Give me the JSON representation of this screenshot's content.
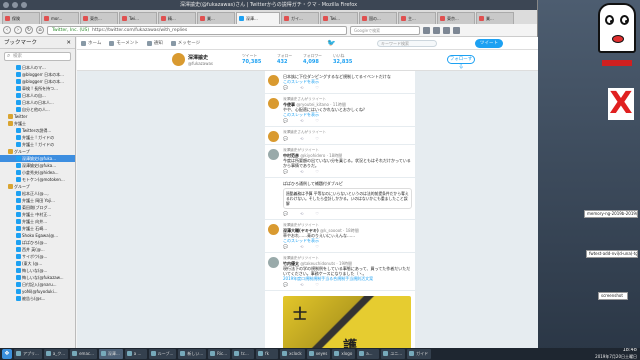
{
  "window": {
    "title": "深澤諭史(@fukazawas)さん | Twitterからの説得ガチ・クマ - Mozilla Firefox"
  },
  "tabs": [
    {
      "label": "保険"
    },
    {
      "label": "mor...",
      "active": false
    },
    {
      "label": "東京..."
    },
    {
      "label": "Twi..."
    },
    {
      "label": "精..."
    },
    {
      "label": "業..."
    },
    {
      "label": "深澤...",
      "active": true
    },
    {
      "label": "ガイ..."
    },
    {
      "label": "Twi..."
    },
    {
      "label": "国の..."
    },
    {
      "label": "主..."
    },
    {
      "label": "東京..."
    },
    {
      "label": "業..."
    }
  ],
  "url": {
    "site": "Twitter, Inc. (US)",
    "path": "https://twitter.com/fukazawas/with_replies"
  },
  "search_placeholder": "Googleで検索",
  "sidebar": {
    "title": "ブックマーク",
    "search_placeholder": "検索",
    "items": [
      {
        "label": "日本人のマ...",
        "lvl": 1
      },
      {
        "label": "@bloggerr 日本の本...",
        "lvl": 1
      },
      {
        "label": "@bloggerr 日本の本...",
        "lvl": 1
      },
      {
        "label": "車検 ! 長所を持つ...",
        "lvl": 1
      },
      {
        "label": "日本人の自...",
        "lvl": 1
      },
      {
        "label": "日本人の日本人...",
        "lvl": 1
      },
      {
        "label": "自分と他の人...",
        "lvl": 1
      },
      {
        "label": "Twitter",
        "lvl": 0,
        "folder": true
      },
      {
        "label": "弁護士",
        "lvl": 0,
        "folder": true
      },
      {
        "label": "Twitterの説得...",
        "lvl": 1
      },
      {
        "label": "弁護士 ! ガイドの",
        "lvl": 1
      },
      {
        "label": "弁護士 ! ガイドの",
        "lvl": 1
      },
      {
        "label": "グループ",
        "lvl": 0,
        "folder": true
      },
      {
        "label": "深澤諭史(@fuka...",
        "lvl": 1,
        "sel": true
      },
      {
        "label": "深澤諭史(@fuka...",
        "lvl": 1
      },
      {
        "label": "小倉秀夫(@hidea...",
        "lvl": 1
      },
      {
        "label": "モトケン(@motoken...",
        "lvl": 1
      },
      {
        "label": "グループ",
        "lvl": 0,
        "folder": true
      },
      {
        "label": "松本正人(@..., ",
        "lvl": 1
      },
      {
        "label": "弁護士 岡田 Yoji...",
        "lvl": 1
      },
      {
        "label": "菊田剛(ブログ...",
        "lvl": 1
      },
      {
        "label": "弁護士 中村正...",
        "lvl": 1
      },
      {
        "label": "弁護士 向井...",
        "lvl": 1
      },
      {
        "label": "弁護士 石崎...",
        "lvl": 1
      },
      {
        "label": "Shoko Egawa(@...",
        "lvl": 1
      },
      {
        "label": "ばばひろ(@...",
        "lvl": 1
      },
      {
        "label": "西井 英(@...",
        "lvl": 1
      },
      {
        "label": "サイボウ(@...",
        "lvl": 1
      },
      {
        "label": "(東大 (@...",
        "lvl": 1
      },
      {
        "label": "悔しいな(@...",
        "lvl": 1
      },
      {
        "label": "悔しいな(@fukazaw...",
        "lvl": 1
      },
      {
        "label": "日付記入(@naru...",
        "lvl": 1
      },
      {
        "label": "yoNi(@fuyoduki...",
        "lvl": 1
      },
      {
        "label": "被告ら(@s...",
        "lvl": 1
      }
    ]
  },
  "twitter_nav": {
    "home": "ホーム",
    "moments": "モーメント",
    "notifications": "通知",
    "messages": "メッセージ"
  },
  "twitter_search_placeholder": "キーワード検索",
  "tweet_button": "ツイート",
  "profile": {
    "name": "深澤諭史",
    "handle": "@fukazawas",
    "stats": [
      {
        "label": "ツイート",
        "value": "70,385"
      },
      {
        "label": "フォロー",
        "value": "432"
      },
      {
        "label": "フォロワー",
        "value": "4,098"
      },
      {
        "label": "いいね",
        "value": "32,835"
      }
    ],
    "follow_label": "フォローする"
  },
  "tweets": [
    {
      "ctx": "",
      "name": "",
      "handle": "",
      "text": "日本族に下位ダンピングするなど規制してるイベントだけな",
      "link": "このスレッドを表示",
      "avatar": "orange"
    },
    {
      "ctx": "深澤諭史さんがリツイート",
      "name": "今使事",
      "handle": "@ryoutei_kitano · 11時間",
      "text": "やや、心配適にはいくかれないとおかしくね？",
      "link": "このスレッドを表示",
      "avatar": "orange"
    },
    {
      "ctx": "深澤諭史さんがリツイート",
      "name": "",
      "handle": "",
      "text": "",
      "link": "",
      "avatar": "orange"
    },
    {
      "ctx": "深澤諭史がリツイート",
      "name": "中村范彦",
      "handle": "@kiyohidero · 18時間",
      "text": "今度は所要額の出ていない分を乗じる。状況ともはそれだけかっているから事情でありだ。",
      "link": "",
      "avatar": "grey"
    },
    {
      "ctx": "",
      "name": "",
      "handle": "",
      "text": "ばばひろ通例して補題付ダブルピ",
      "quote": "過酷義務は予算 平等なのにいらないというのは法的前提条件だから奪えるわけない。そしたら会計しかかる。いのはないかにも重ましたこと誤解",
      "link": "",
      "avatar": ""
    },
    {
      "ctx": "深澤諭史がリツイート",
      "name": "深澤大輔(ヤキヤキ)",
      "handle": "@k_soooot · 18時間",
      "text": "草やおれ……青のりえいにぃえんな……",
      "link": "このスレッドを表示",
      "avatar": "orange"
    },
    {
      "ctx": "深澤諭史がリツイート",
      "name": "竹内優太",
      "handle": "@takeuchidonuts · 19時間",
      "text": "現行法下の学の規制例をしている事態にあって、買ってた作者だいただいてください。事務ケースになりました（ヽ。",
      "link": "2019年度ロ規制規制手当る合規制手当規則活文案",
      "avatar": "grey"
    }
  ],
  "media_glyphs": [
    "士",
    "護"
  ],
  "desktop": {
    "notes": [
      "memory-ng-2019b-2019/4",
      "fwtest-add-nvi(d-una)-tg",
      "screenshot"
    ],
    "x_mark": "X"
  },
  "taskbar": {
    "items": [
      "アプリ...",
      "a_ク...",
      "emac...",
      "深澤...",
      "a ...",
      "ルーブ...",
      "新しい...",
      "Ric...",
      "tc...",
      "fk",
      "xclock",
      "xeyes",
      "xlogo",
      "a...",
      "ユニ...",
      "ガイド"
    ],
    "clock_time": "18:48",
    "clock_date": "2019年7月20日土曜日"
  }
}
